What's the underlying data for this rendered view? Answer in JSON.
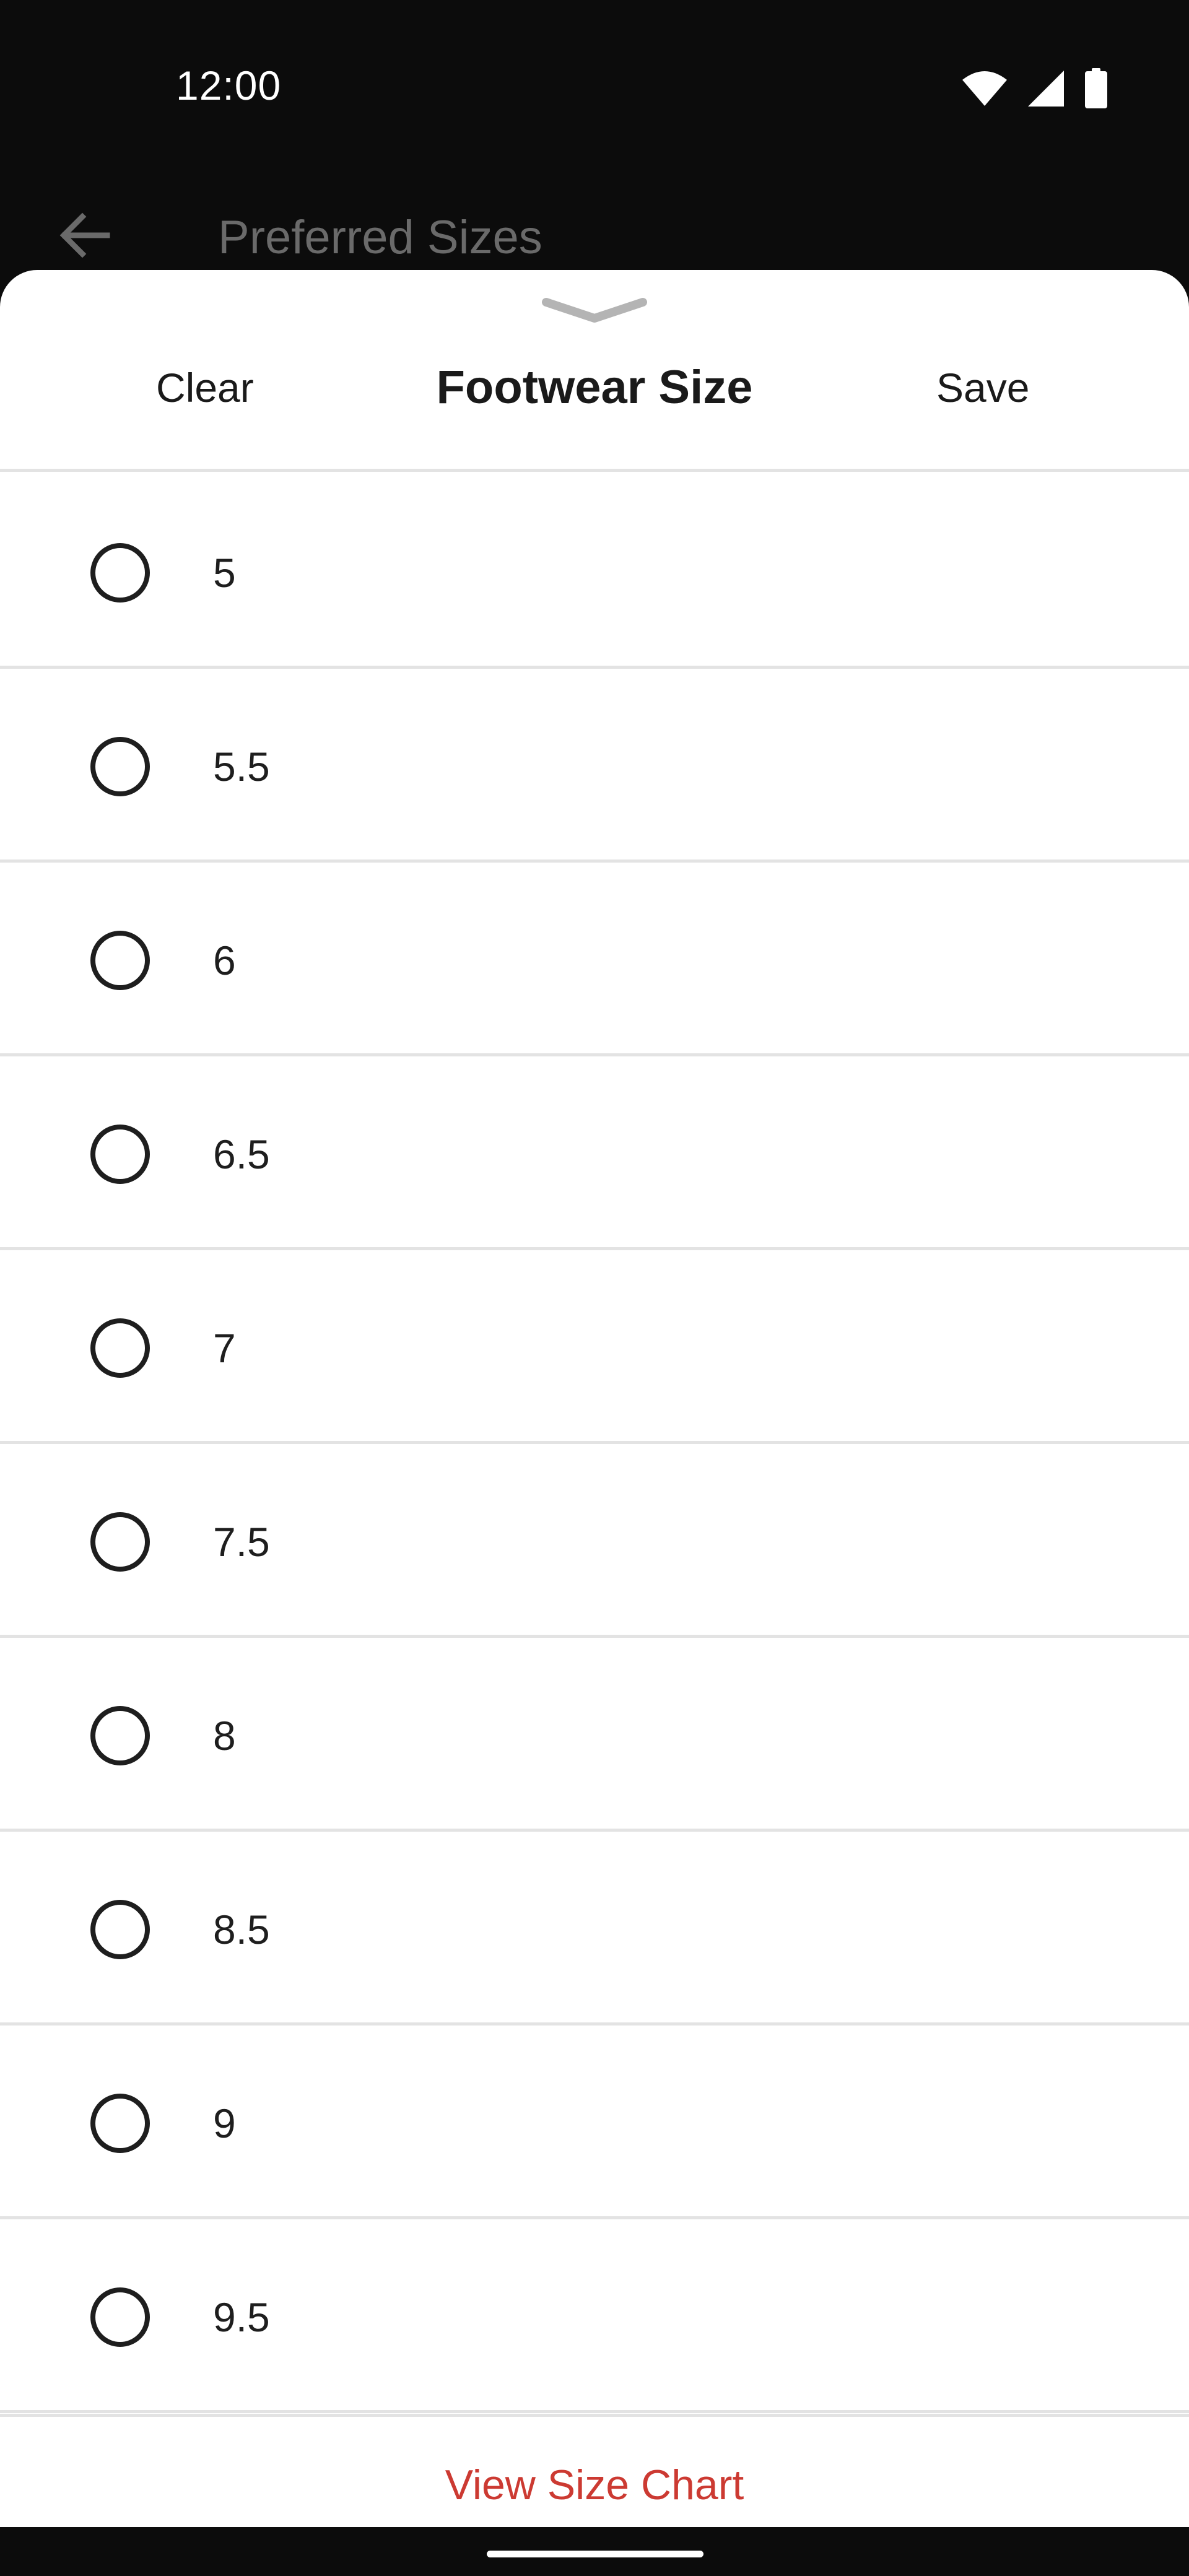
{
  "status_bar": {
    "time": "12:00",
    "icons": [
      "wifi-icon",
      "cell-signal-icon",
      "battery-icon"
    ]
  },
  "app_bar": {
    "title": "Preferred Sizes",
    "back_icon": "arrow-back-icon"
  },
  "sheet": {
    "handle_icon": "chevron-down-icon",
    "clear_label": "Clear",
    "title": "Footwear Size",
    "save_label": "Save",
    "sizes": [
      {
        "label": "5",
        "selected": false
      },
      {
        "label": "5.5",
        "selected": false
      },
      {
        "label": "6",
        "selected": false
      },
      {
        "label": "6.5",
        "selected": false
      },
      {
        "label": "7",
        "selected": false
      },
      {
        "label": "7.5",
        "selected": false
      },
      {
        "label": "8",
        "selected": false
      },
      {
        "label": "8.5",
        "selected": false
      },
      {
        "label": "9",
        "selected": false
      },
      {
        "label": "9.5",
        "selected": false
      }
    ],
    "footer_link": "View Size Chart"
  },
  "colors": {
    "accent": "#cc3a32",
    "background_dark": "#0c0c0c",
    "sheet_bg": "#ffffff",
    "divider": "#e3e3e3",
    "text": "#1e1e1e"
  }
}
